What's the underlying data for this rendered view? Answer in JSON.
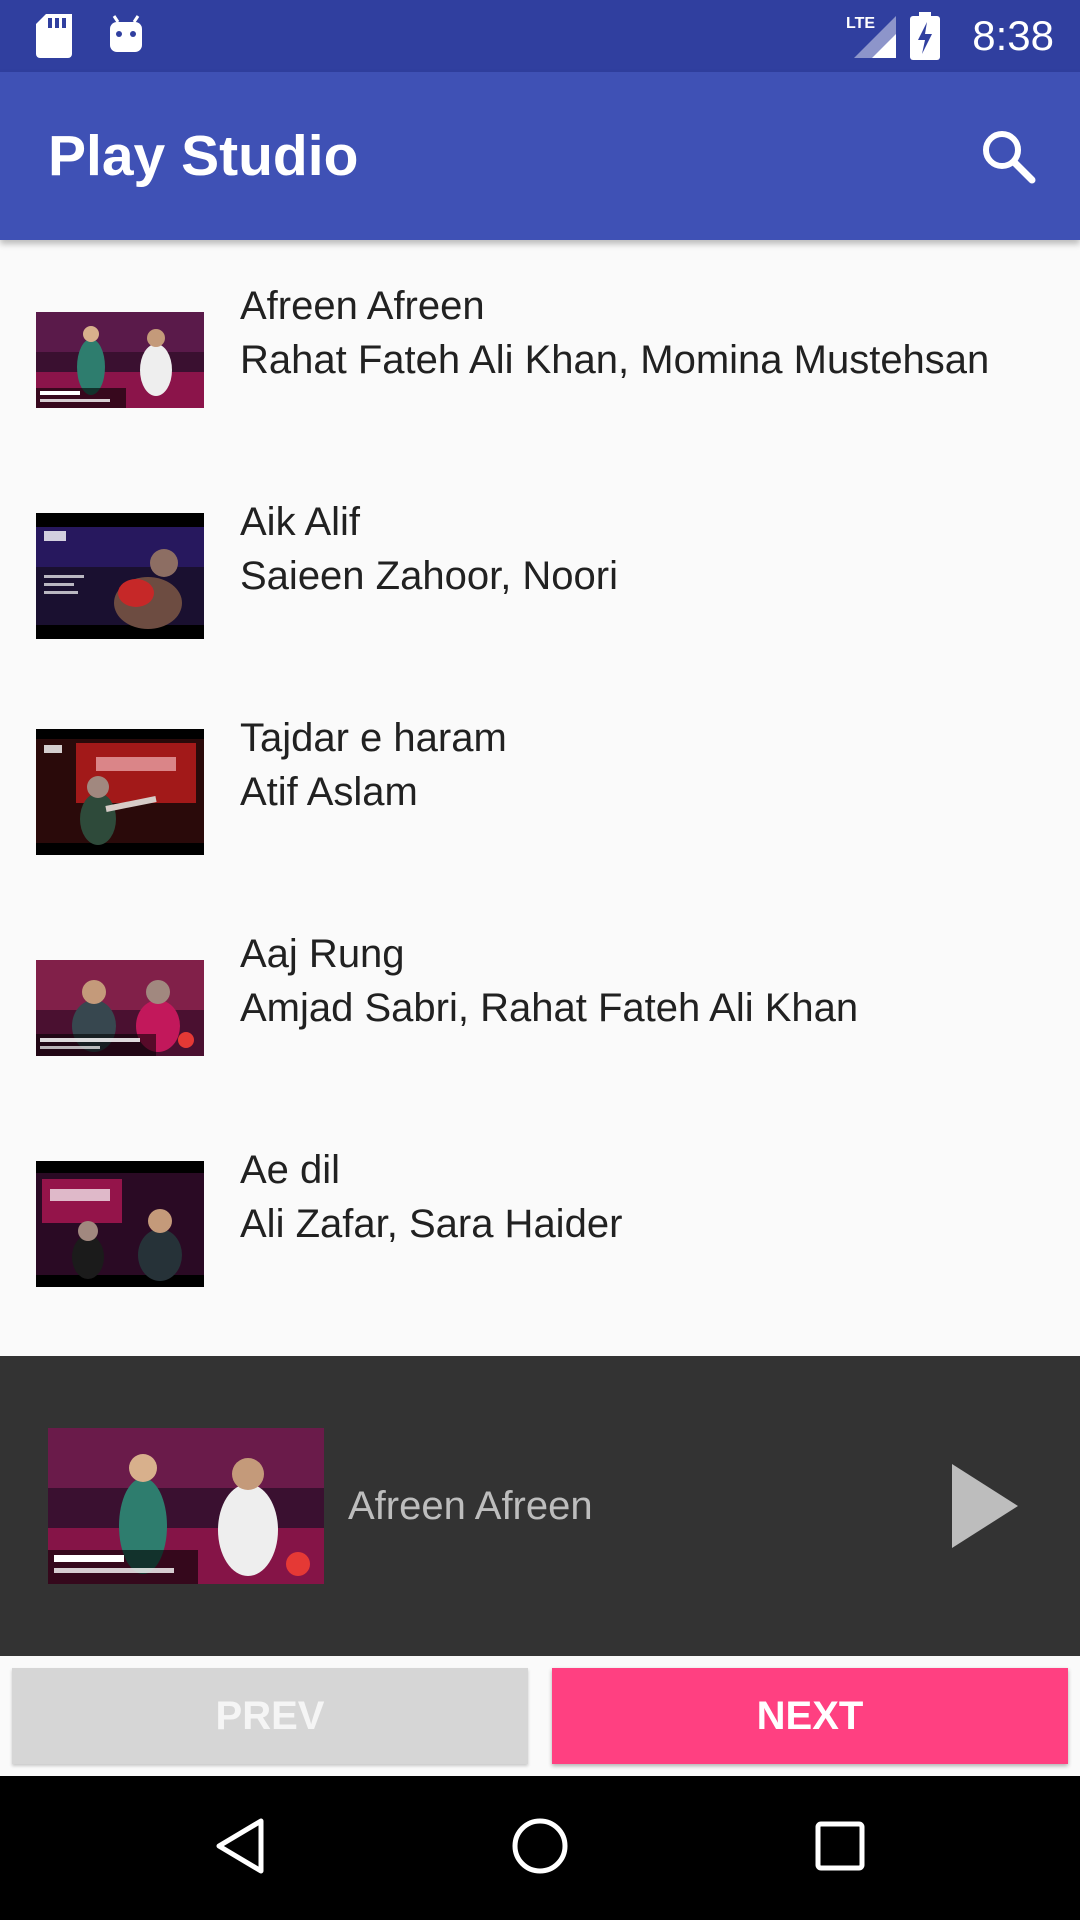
{
  "status_bar": {
    "network": "LTE",
    "time": "8:38",
    "icons": [
      "sd-card-icon",
      "android-debug-icon",
      "signal-icon",
      "battery-charging-icon"
    ]
  },
  "app_bar": {
    "title": "Play Studio",
    "search_icon": "search-icon"
  },
  "songs": [
    {
      "title": "Afreen Afreen",
      "artist": "Rahat Fateh Ali Khan, Momina Mustehsan"
    },
    {
      "title": "Aik Alif",
      "artist": "Saieen Zahoor, Noori"
    },
    {
      "title": "Tajdar e haram",
      "artist": "Atif Aslam"
    },
    {
      "title": "Aaj Rung",
      "artist": "Amjad Sabri,  Rahat Fateh Ali Khan"
    },
    {
      "title": "Ae dil",
      "artist": "Ali Zafar, Sara Haider"
    }
  ],
  "now_playing": {
    "title": "Afreen Afreen",
    "play_icon": "play-icon"
  },
  "controls": {
    "prev_label": "PREV",
    "next_label": "NEXT"
  },
  "nav": {
    "icons": [
      "back-icon",
      "home-icon",
      "recents-icon"
    ]
  },
  "colors": {
    "status_bar": "#303F9F",
    "app_bar": "#3F51B5",
    "accent": "#FF4081",
    "player_bg": "#333333",
    "prev_button": "#D6D6D6"
  }
}
